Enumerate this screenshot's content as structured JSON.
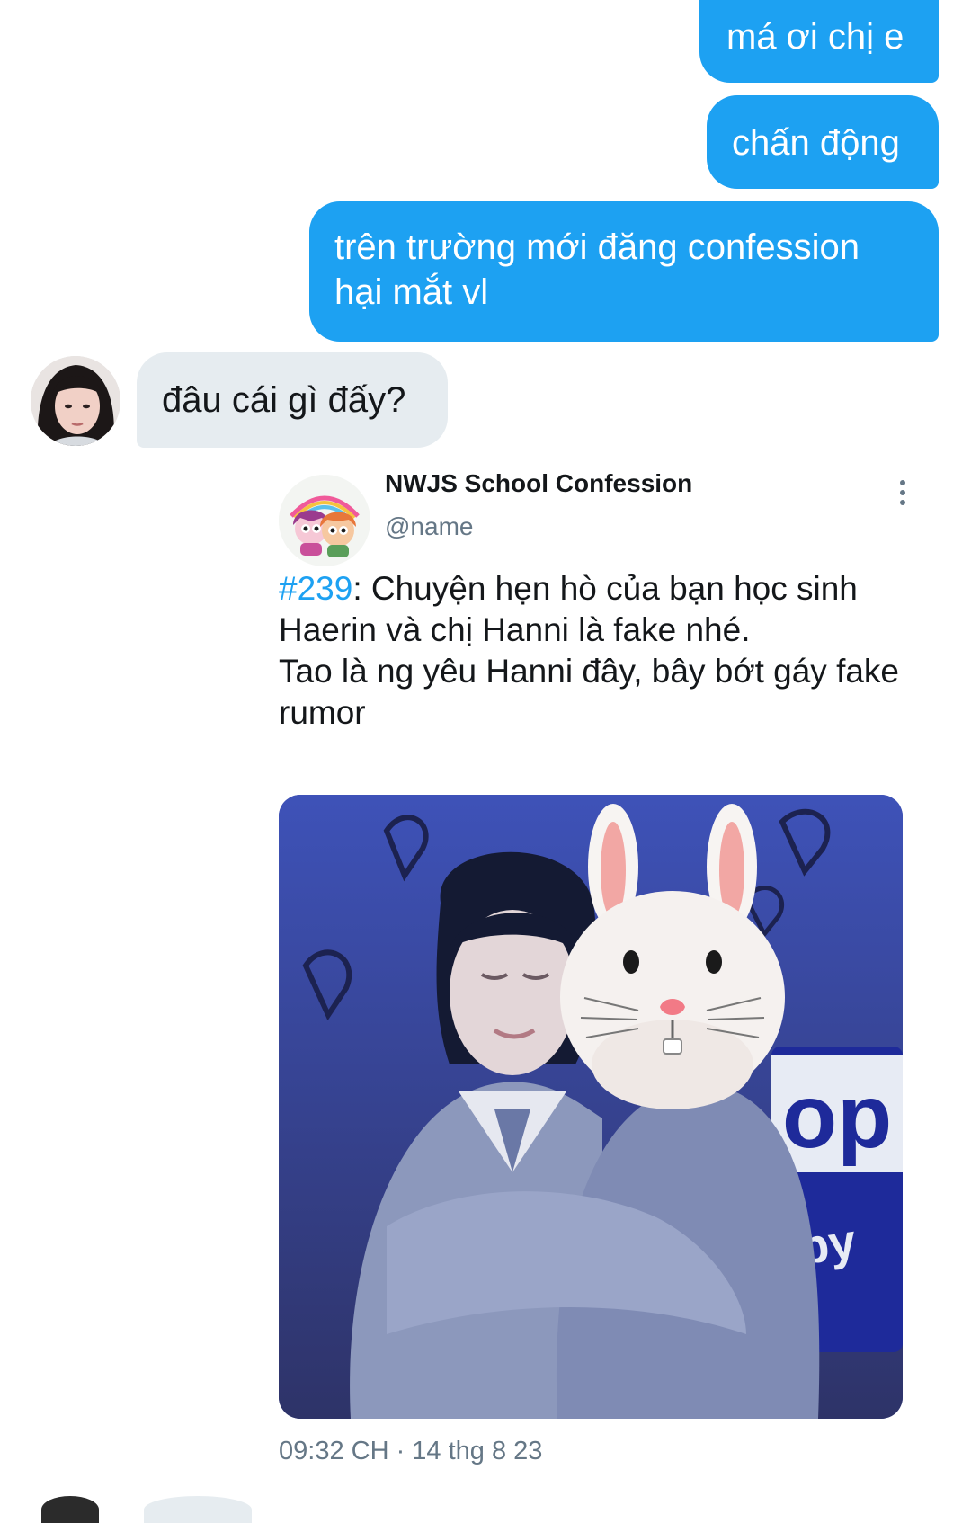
{
  "messages": {
    "sent": [
      {
        "lines": [
          "má ơi chị e"
        ]
      },
      {
        "lines": [
          "chấn động"
        ]
      },
      {
        "lines": [
          "trên trường mới đăng confession",
          "hại mắt vl"
        ]
      }
    ],
    "received": {
      "text": "đâu cái gì đấy?"
    }
  },
  "tweet": {
    "author_name": "NWJS School Confession",
    "author_handle": "@name",
    "text": {
      "hashtag": "#239",
      "line1_rest": ": Chuyện hẹn hò của bạn học sinh",
      "line2": "Haerin và chị Hanni là fake nhé.",
      "line3": "Tao là ng yêu Hanni đây, bây bớt gáy fake",
      "line4": "rumor"
    },
    "photo_text": {
      "sign_top": "op",
      "sign_bottom": "by"
    },
    "timestamp": "09:32 CH · 14 thg 8 23"
  },
  "colors": {
    "sent_bubble": "#1da1f2",
    "received_bubble": "#e6ecf0",
    "link": "#1da1f2",
    "muted": "#657786"
  },
  "icons": {
    "more_menu": "more-vertical-icon"
  }
}
